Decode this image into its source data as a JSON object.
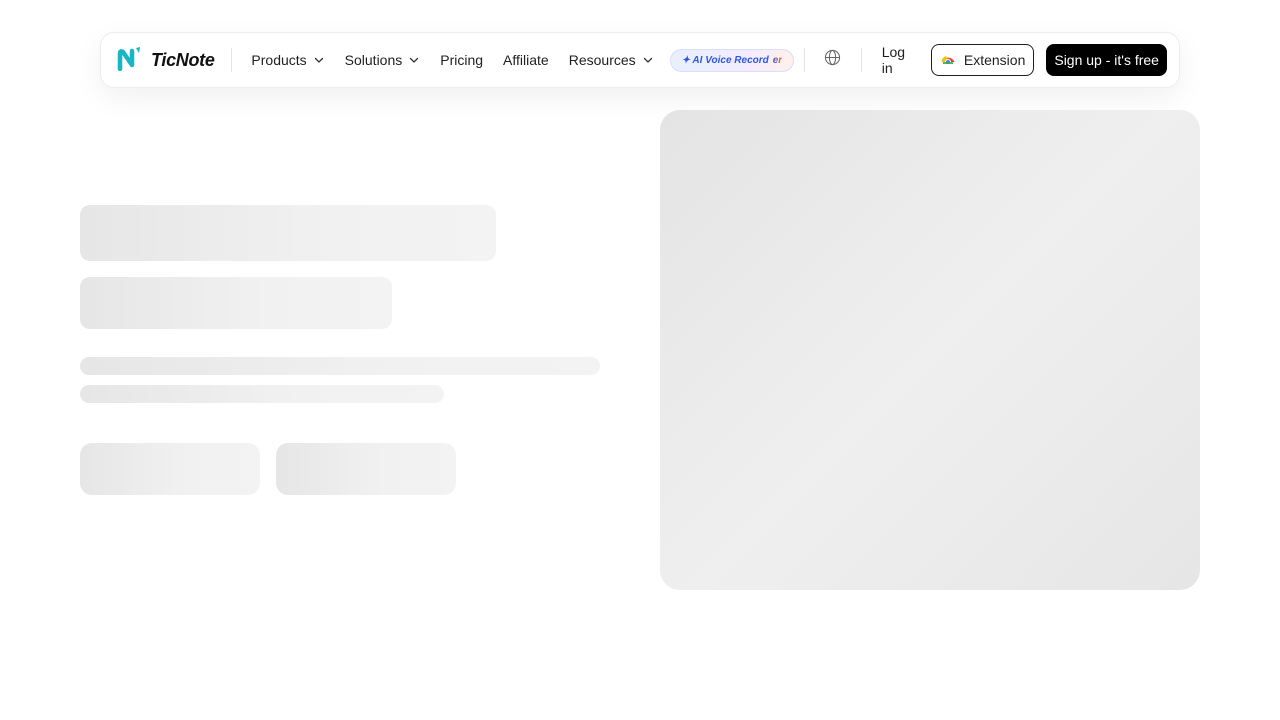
{
  "nav": {
    "brand": "TicNote",
    "items": [
      {
        "label": "Products",
        "has_dropdown": true
      },
      {
        "label": "Solutions",
        "has_dropdown": true
      },
      {
        "label": "Pricing",
        "has_dropdown": false
      },
      {
        "label": "Affiliate",
        "has_dropdown": false
      },
      {
        "label": "Resources",
        "has_dropdown": true
      }
    ],
    "badge_prefix": "✦ AI Voice Record",
    "badge_suffix": "er",
    "language_icon": "globe-icon",
    "login_label": "Log in",
    "extension_label": "Extension",
    "extension_icon": "chrome-icon",
    "signup_label": "Sign up - it's free"
  },
  "colors": {
    "brand_teal": "#16b6c4",
    "badge_text": "#2c5be0",
    "cta_background": "#000000",
    "skeleton": "#ececec"
  },
  "loading_state": "skeleton placeholders"
}
